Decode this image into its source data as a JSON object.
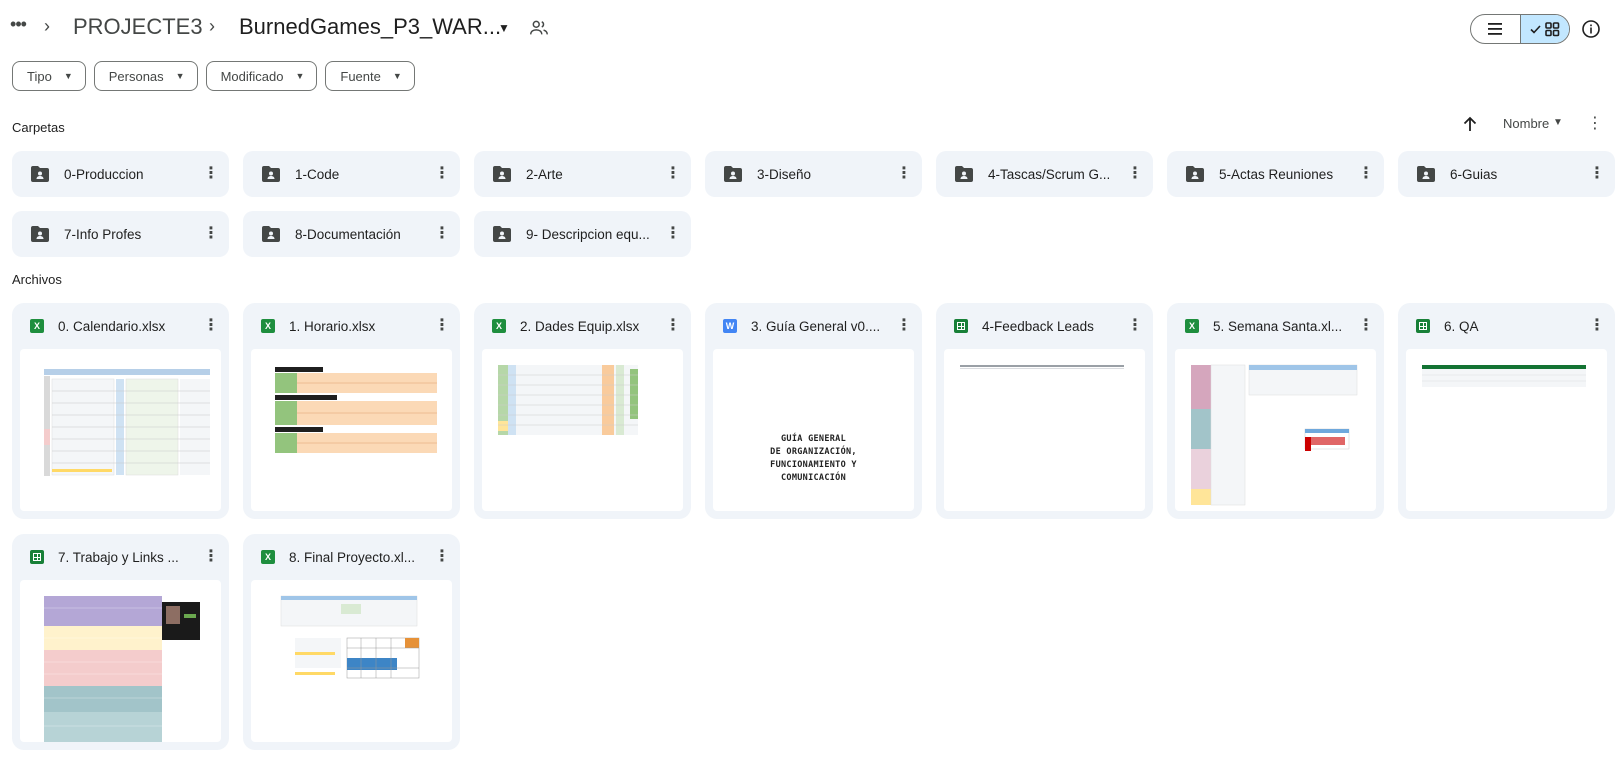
{
  "header": {
    "more_label": "•••",
    "parent_folder": "PROJECTE3",
    "current_folder": "BurnedGames_P3_WAR...",
    "colors": {
      "accent_toggle": "#c2e7ff",
      "card_bg": "#f0f4f9"
    }
  },
  "filters": [
    {
      "label": "Tipo"
    },
    {
      "label": "Personas"
    },
    {
      "label": "Modificado"
    },
    {
      "label": "Fuente"
    }
  ],
  "sort": {
    "label": "Nombre"
  },
  "sections": {
    "folders": "Carpetas",
    "files": "Archivos"
  },
  "folders": [
    {
      "name": "0-Produccion"
    },
    {
      "name": "1-Code"
    },
    {
      "name": "2-Arte"
    },
    {
      "name": "3-Diseño"
    },
    {
      "name": "4-Tascas/Scrum G..."
    },
    {
      "name": "5-Actas Reuniones"
    },
    {
      "name": "6-Guias"
    },
    {
      "name": "7-Info Profes"
    },
    {
      "name": "8-Documentación"
    },
    {
      "name": "9- Descripcion equ..."
    }
  ],
  "files": [
    {
      "name": "0. Calendario.xlsx",
      "type": "xlsx",
      "icon_letter": "X"
    },
    {
      "name": "1. Horario.xlsx",
      "type": "xlsx",
      "icon_letter": "X"
    },
    {
      "name": "2. Dades Equip.xlsx",
      "type": "xlsx",
      "icon_letter": "X"
    },
    {
      "name": "3. Guía General v0....",
      "type": "docx",
      "icon_letter": "W",
      "thumb_text": [
        "GUÍA GENERAL",
        "DE ORGANIZACIÓN,",
        "FUNCIONAMIENTO Y",
        "COMUNICACIÓN"
      ]
    },
    {
      "name": "4-Feedback Leads",
      "type": "sheet"
    },
    {
      "name": "5. Semana Santa.xl...",
      "type": "xlsx",
      "icon_letter": "X"
    },
    {
      "name": "6. QA",
      "type": "sheet"
    },
    {
      "name": "7. Trabajo y Links ...",
      "type": "sheet"
    },
    {
      "name": "8. Final Proyecto.xl...",
      "type": "xlsx",
      "icon_letter": "X"
    }
  ]
}
